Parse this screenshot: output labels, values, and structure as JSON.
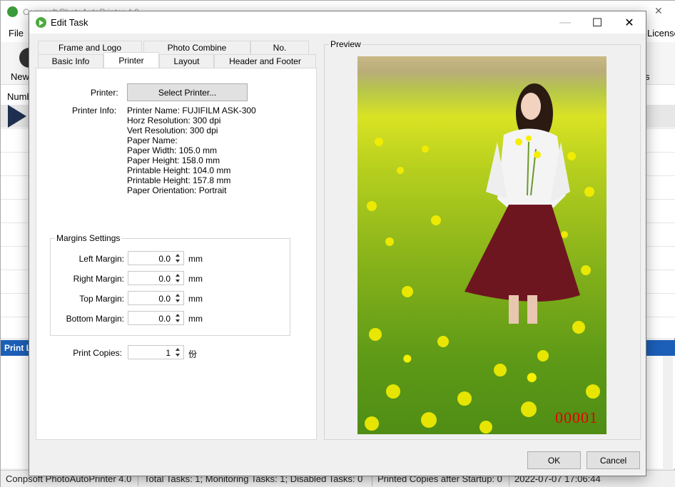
{
  "main": {
    "title": "Conpsoft PhotoAutoPrinter 4.0",
    "menu": {
      "file": "File",
      "license": "License"
    },
    "toolbar": {
      "new": "New",
      "right": "s"
    },
    "list_header": "Numb",
    "printlog": "Print L",
    "status": {
      "app": "Conpsoft PhotoAutoPrinter 4.0",
      "tasks": "Total Tasks: 1; Monitoring Tasks: 1; Disabled Tasks: 0",
      "copies": "Printed Copies after Startup: 0",
      "time": "2022-07-07 17:06:44"
    }
  },
  "dialog": {
    "title": "Edit Task",
    "tabs_top": [
      "Frame and Logo",
      "Photo Combine",
      "No."
    ],
    "tabs_bottom": [
      "Basic Info",
      "Printer",
      "Layout",
      "Header and Footer"
    ],
    "active_tab": "Printer",
    "printer_label": "Printer:",
    "select_printer": "Select Printer...",
    "printer_info_label": "Printer Info:",
    "printer_info": [
      "Printer Name: FUJIFILM ASK-300",
      "Horz Resolution: 300 dpi",
      "Vert Resolution: 300 dpi",
      "Paper Name:",
      "Paper Width: 105.0 mm",
      "Paper Height: 158.0 mm",
      "Printable Height: 104.0 mm",
      "Printable Height: 157.8 mm",
      "Paper Orientation: Portrait"
    ],
    "margins": {
      "legend": "Margins Settings",
      "left_label": "Left Margin:",
      "left_value": "0.0",
      "right_label": "Right Margin:",
      "right_value": "0.0",
      "top_label": "Top Margin:",
      "top_value": "0.0",
      "bottom_label": "Bottom Margin:",
      "bottom_value": "0.0",
      "unit": "mm"
    },
    "copies": {
      "label": "Print Copies:",
      "value": "1",
      "unit": "份"
    },
    "preview": {
      "legend": "Preview",
      "serial": "00001"
    },
    "ok": "OK",
    "cancel": "Cancel"
  }
}
